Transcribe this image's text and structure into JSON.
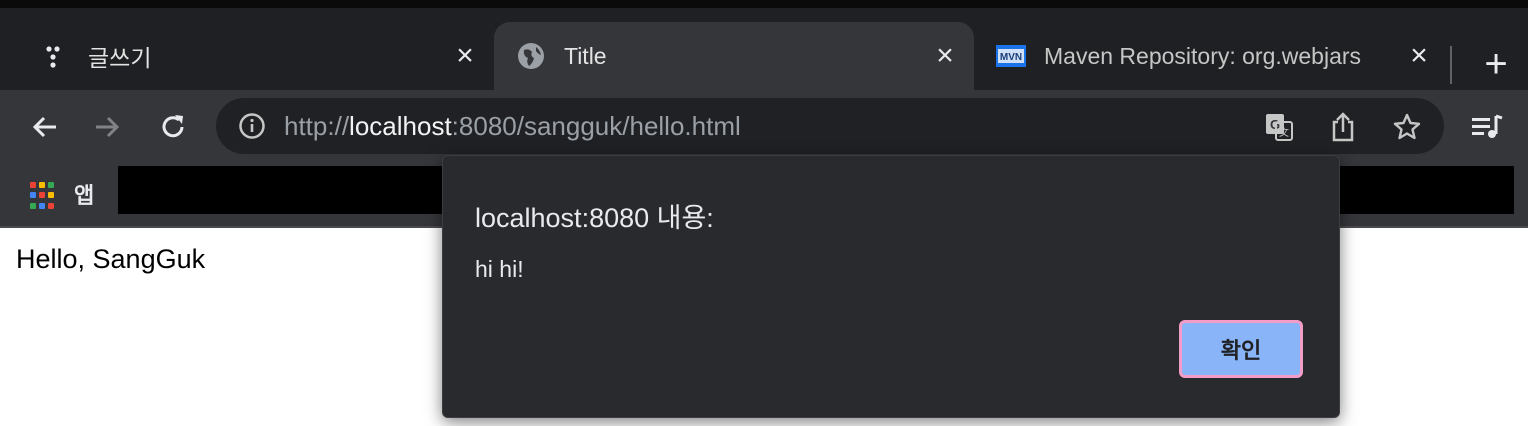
{
  "tabs": [
    {
      "label": "글쓰기",
      "icon": "three-dots-favicon",
      "active": false
    },
    {
      "label": "Title",
      "icon": "globe-favicon",
      "active": true
    },
    {
      "label": "Maven Repository: org.webjars",
      "icon": "mvn-favicon",
      "active": false
    }
  ],
  "toolbar": {
    "url_scheme": "http://",
    "url_host": "localhost",
    "url_rest": ":8080/sangguk/hello.html"
  },
  "bookmarks": {
    "apps_label": "앱"
  },
  "page": {
    "text": "Hello, SangGuk"
  },
  "dialog": {
    "title": "localhost:8080 내용:",
    "message": "hi hi!",
    "ok_label": "확인"
  },
  "colors": {
    "tabstrip": "#1f2023",
    "active_tab": "#35363a",
    "omnibox": "#202124",
    "dialog_bg": "#292a2d",
    "ok_button": "#8ab4f8",
    "focus_ring": "#f29cc8"
  }
}
